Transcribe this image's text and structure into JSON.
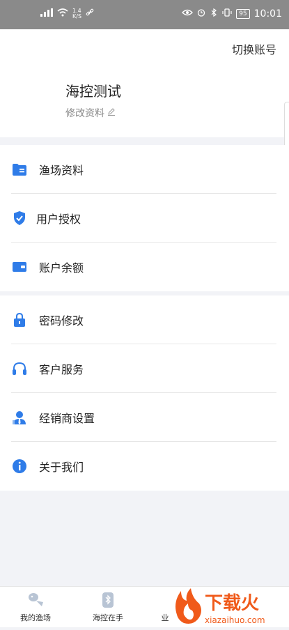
{
  "status_bar": {
    "network_speed_value": "1.4",
    "network_speed_unit": "K/S",
    "battery": "95",
    "time": "10:01"
  },
  "header": {
    "switch_account": "切换账号",
    "profile_name": "海控测试",
    "edit_profile": "修改资料"
  },
  "menu": {
    "group1": [
      {
        "label": "渔场资料",
        "icon": "folder-icon"
      },
      {
        "label": "用户授权",
        "icon": "shield-check-icon"
      },
      {
        "label": "账户余额",
        "icon": "wallet-icon"
      }
    ],
    "group2": [
      {
        "label": "密码修改",
        "icon": "lock-icon"
      },
      {
        "label": "客户服务",
        "icon": "headphones-icon"
      },
      {
        "label": "经销商设置",
        "icon": "dealer-icon"
      },
      {
        "label": "关于我们",
        "icon": "info-icon"
      }
    ]
  },
  "tabbar": {
    "tabs": [
      {
        "label": "我的渔场",
        "icon": "fish-icon"
      },
      {
        "label": "海控在手",
        "icon": "bluetooth-device-icon"
      },
      {
        "label": "业",
        "icon": "unknown-icon"
      }
    ]
  },
  "watermark": {
    "text": "下载火",
    "subtext": "xiazaihuo.com"
  },
  "colors": {
    "accent": "#2f7ce8",
    "status_bar_bg": "#8a8a8a",
    "page_bg": "#f2f3f7",
    "watermark_orange": "#f05a1a"
  }
}
